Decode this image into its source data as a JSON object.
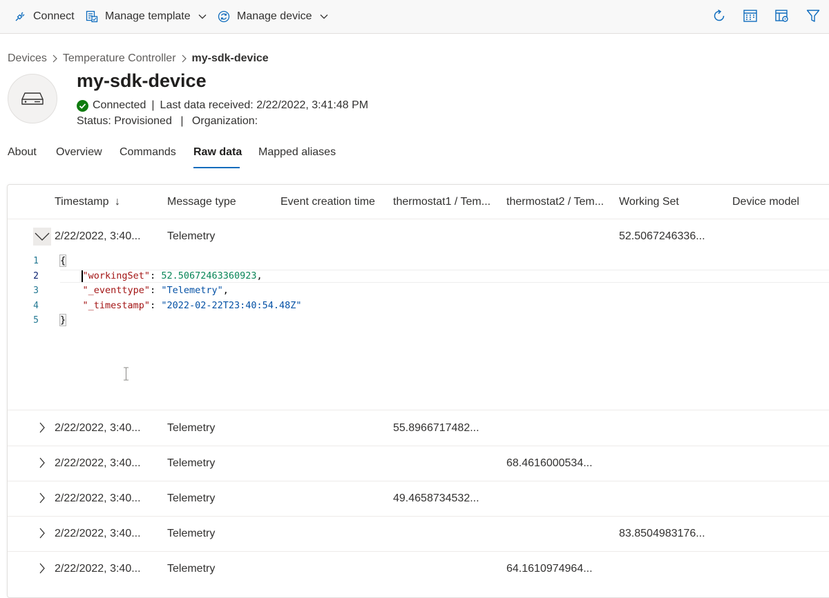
{
  "toolbar": {
    "connect_label": "Connect",
    "manage_template_label": "Manage template",
    "manage_device_label": "Manage device",
    "accent_color": "#0f6cbd"
  },
  "breadcrumb": {
    "items": [
      "Devices",
      "Temperature Controller"
    ],
    "current": "my-sdk-device"
  },
  "device": {
    "name": "my-sdk-device",
    "connection_status": "Connected",
    "last_data_label": "Last data received: 2/22/2022, 3:41:48 PM",
    "status_label": "Status: Provisioned",
    "organization_label": "Organization:",
    "status_color": "#107c10"
  },
  "tabs": {
    "items": [
      "About",
      "Overview",
      "Commands",
      "Raw data",
      "Mapped aliases"
    ],
    "active": "Raw data"
  },
  "grid": {
    "sort_indicator": "↓",
    "columns": [
      "Timestamp",
      "Message type",
      "Event creation time",
      "thermostat1 / Tem...",
      "thermostat2 / Tem...",
      "Working Set",
      "Device model"
    ],
    "rows": [
      {
        "timestamp": "2/22/2022, 3:40...",
        "type": "Telemetry",
        "event_time": "",
        "thermostat1": "",
        "thermostat2": "",
        "working_set": "52.5067246336...",
        "device_model": ""
      },
      {
        "timestamp": "2/22/2022, 3:40...",
        "type": "Telemetry",
        "event_time": "",
        "thermostat1": "55.8966717482...",
        "thermostat2": "",
        "working_set": "",
        "device_model": ""
      },
      {
        "timestamp": "2/22/2022, 3:40...",
        "type": "Telemetry",
        "event_time": "",
        "thermostat1": "",
        "thermostat2": "68.4616000534...",
        "working_set": "",
        "device_model": ""
      },
      {
        "timestamp": "2/22/2022, 3:40...",
        "type": "Telemetry",
        "event_time": "",
        "thermostat1": "49.4658734532...",
        "thermostat2": "",
        "working_set": "",
        "device_model": ""
      },
      {
        "timestamp": "2/22/2022, 3:40...",
        "type": "Telemetry",
        "event_time": "",
        "thermostat1": "",
        "thermostat2": "",
        "working_set": "83.8504983176...",
        "device_model": ""
      },
      {
        "timestamp": "2/22/2022, 3:40...",
        "type": "Telemetry",
        "event_time": "",
        "thermostat1": "",
        "thermostat2": "64.1610974964...",
        "working_set": "",
        "device_model": ""
      }
    ]
  },
  "code": {
    "line_numbers": [
      "1",
      "2",
      "3",
      "4",
      "5"
    ],
    "open_brace": "{",
    "close_brace": "}",
    "lines": [
      {
        "key": "\"workingSet\"",
        "value": "52.50672463360923"
      },
      {
        "key": "\"_eventtype\"",
        "value": "\"Telemetry\""
      },
      {
        "key": "\"_timestamp\"",
        "value": "\"2022-02-22T23:40:54.48Z\""
      }
    ]
  },
  "icons": {
    "connect": "plug-icon",
    "manage_template": "template-icon",
    "manage_device": "manage-device-icon",
    "refresh": "refresh-icon",
    "calendar": "calendar-icon",
    "column_settings": "column-settings-icon",
    "filter": "filter-icon"
  }
}
